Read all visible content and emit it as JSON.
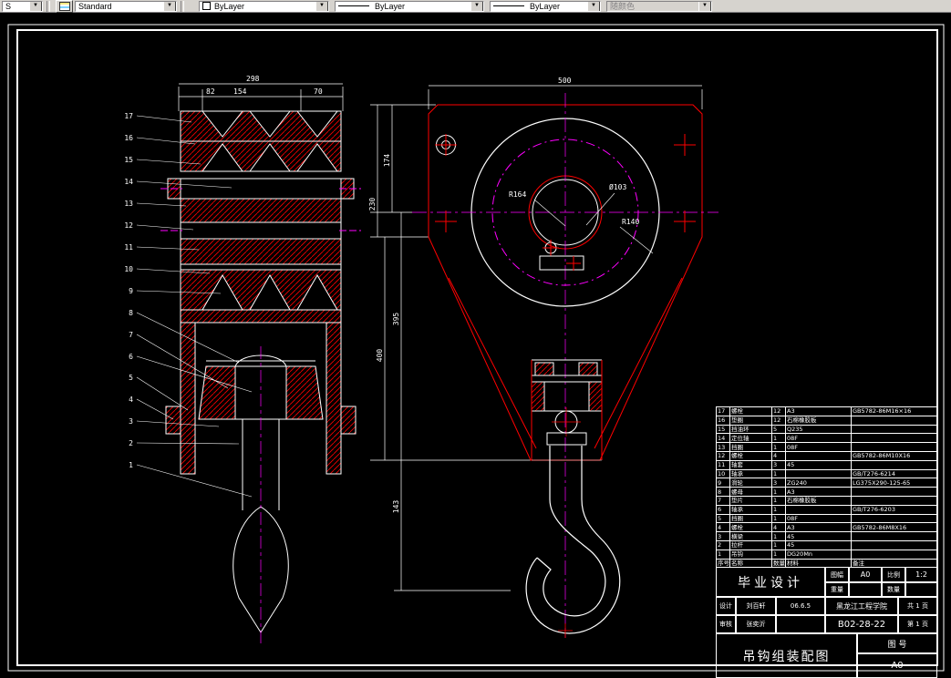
{
  "toolbar": {
    "dim_style": "S",
    "text_style": "Standard",
    "color": "ByLayer",
    "linetype": "ByLayer",
    "lineweight": "ByLayer",
    "plot_style": "随颜色",
    "icons": {
      "dropdown_arrow": "▼",
      "layers_button": "layers-icon"
    }
  },
  "drawing": {
    "left_view": {
      "dims": {
        "overall": "298",
        "a": "82",
        "b": "154",
        "c": "70"
      },
      "callouts": [
        "17",
        "16",
        "15",
        "14",
        "13",
        "12",
        "11",
        "10",
        "9",
        "8",
        "7",
        "6",
        "5",
        "4",
        "3",
        "2",
        "1"
      ]
    },
    "right_view": {
      "dims": {
        "width": "500",
        "h_174": "174",
        "h_230": "230",
        "h_395": "395",
        "h_400": "400",
        "h_143": "143"
      },
      "labels": {
        "r164": "R164",
        "d103": "Ø103",
        "r140": "R140"
      }
    },
    "colors": {
      "geometry": "#ffffff",
      "section": "#ff0000",
      "centerline": "#ff00ff"
    }
  },
  "bom": {
    "headers": [
      "序号",
      "名称",
      "数量",
      "材料",
      "备注"
    ],
    "rows": [
      {
        "no": "17",
        "name": "螺栓",
        "qty": "12",
        "mat": "A3",
        "std": "GB5782-86M16×16"
      },
      {
        "no": "16",
        "name": "垫圈",
        "qty": "12",
        "mat": "石棉橡胶板",
        "std": ""
      },
      {
        "no": "15",
        "name": "挡油环",
        "qty": "5",
        "mat": "Q235",
        "std": ""
      },
      {
        "no": "14",
        "name": "定位轴",
        "qty": "1",
        "mat": "08F",
        "std": ""
      },
      {
        "no": "13",
        "name": "挡圈",
        "qty": "1",
        "mat": "08F",
        "std": ""
      },
      {
        "no": "12",
        "name": "螺栓",
        "qty": "4",
        "mat": "",
        "std": "GB5782-86M10X16"
      },
      {
        "no": "11",
        "name": "轴套",
        "qty": "3",
        "mat": "45",
        "std": ""
      },
      {
        "no": "10",
        "name": "轴承",
        "qty": "1",
        "mat": "",
        "std": "GB/T276-6214"
      },
      {
        "no": "9",
        "name": "滑轮",
        "qty": "3",
        "mat": "ZG240",
        "std": "LG375X290-125-65"
      },
      {
        "no": "8",
        "name": "螺母",
        "qty": "1",
        "mat": "A3",
        "std": ""
      },
      {
        "no": "7",
        "name": "垫片",
        "qty": "1",
        "mat": "石棉橡胶板",
        "std": ""
      },
      {
        "no": "6",
        "name": "轴承",
        "qty": "1",
        "mat": "",
        "std": "GB/T276-6203"
      },
      {
        "no": "5",
        "name": "挡圈",
        "qty": "1",
        "mat": "08F",
        "std": ""
      },
      {
        "no": "4",
        "name": "螺栓",
        "qty": "4",
        "mat": "A3",
        "std": "GB5782-86M8X16"
      },
      {
        "no": "3",
        "name": "横梁",
        "qty": "1",
        "mat": "45",
        "std": ""
      },
      {
        "no": "2",
        "name": "拉杆",
        "qty": "1",
        "mat": "45",
        "std": ""
      },
      {
        "no": "1",
        "name": "吊钩",
        "qty": "1",
        "mat": "DG20Mn",
        "std": ""
      }
    ]
  },
  "titleblock": {
    "project": "毕业设计",
    "sheet_label": "图幅",
    "sheet": "A0",
    "scale_label": "比例",
    "scale": "1:2",
    "weight_label": "重量",
    "weight": "",
    "qty_label": "数量",
    "qty": "",
    "design_label": "设计",
    "designer": "刘百轩",
    "date": "06.6.5",
    "school": "黑龙江工程学院",
    "pages_total": "共 1 页",
    "check_label": "审核",
    "checker": "张奕沂",
    "drawing_no": "B02-28-22",
    "page_no": "第 1 页",
    "title": "吊钩组装配图",
    "fig_label": "图 号",
    "fig_no": "A0"
  }
}
